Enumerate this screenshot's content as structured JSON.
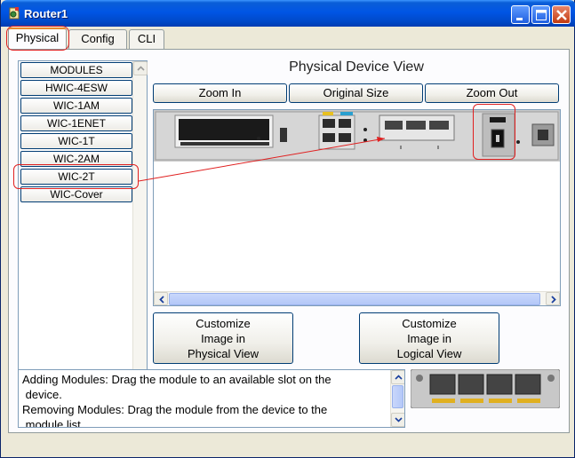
{
  "window": {
    "title": "Router1",
    "minimize_label": "Minimize",
    "maximize_label": "Maximize",
    "close_label": "Close"
  },
  "tabs": [
    {
      "label": "Physical",
      "active": true
    },
    {
      "label": "Config",
      "active": false
    },
    {
      "label": "CLI",
      "active": false
    }
  ],
  "module_list": {
    "items": [
      "MODULES",
      "HWIC-4ESW",
      "WIC-1AM",
      "WIC-1ENET",
      "WIC-1T",
      "WIC-2AM",
      "WIC-2T",
      "WIC-Cover"
    ],
    "highlighted": "WIC-2T"
  },
  "device_view": {
    "title": "Physical Device View",
    "zoom_in": "Zoom In",
    "original_size": "Original Size",
    "zoom_out": "Zoom Out"
  },
  "customize": {
    "physical": [
      "Customize",
      "Image in",
      "Physical View"
    ],
    "logical": [
      "Customize",
      "Image in",
      "Logical View"
    ]
  },
  "help": {
    "line1": "Adding Modules: Drag the module to an available slot on the",
    "line2": " device.",
    "line3": "Removing Modules: Drag the module from the device to the",
    "line4": " module list."
  },
  "colors": {
    "titlebar": "#0055e5",
    "annotation_red": "#e02020",
    "button_border": "#003c74"
  }
}
